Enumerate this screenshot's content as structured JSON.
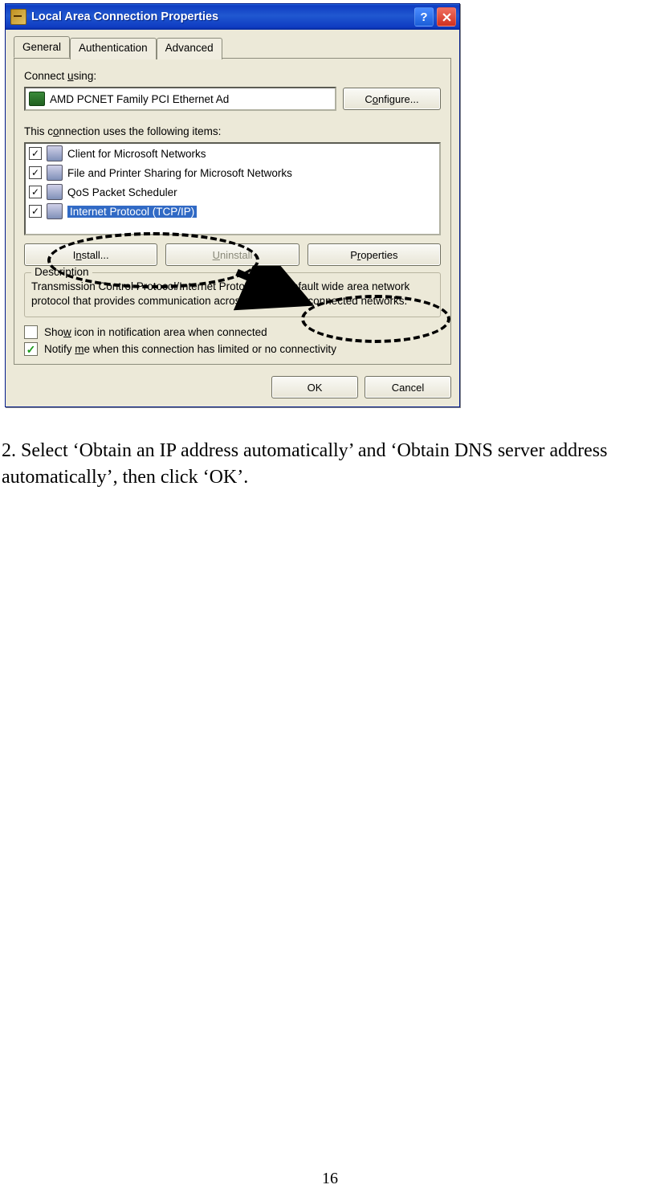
{
  "dialog": {
    "title": "Local Area Connection Properties",
    "tabs": [
      "General",
      "Authentication",
      "Advanced"
    ],
    "connect_label_pre": "Connect ",
    "connect_label_u": "u",
    "connect_label_post": "sing:",
    "adapter": "AMD PCNET Family PCI Ethernet Ad",
    "configure_pre": "C",
    "configure_u": "o",
    "configure_post": "nfigure...",
    "items_label_pre": "This c",
    "items_label_u": "o",
    "items_label_post": "nnection uses the following items:",
    "items": [
      {
        "name": "Client for Microsoft Networks",
        "checked": true
      },
      {
        "name": "File and Printer Sharing for Microsoft Networks",
        "checked": true
      },
      {
        "name": "QoS Packet Scheduler",
        "checked": true
      },
      {
        "name": "Internet Protocol (TCP/IP)",
        "checked": true,
        "selected": true
      }
    ],
    "install_u": "n",
    "install_pre": "I",
    "install_post": "stall...",
    "uninstall_u": "U",
    "uninstall_post": "ninstall",
    "properties_u": "r",
    "properties_pre": "P",
    "properties_post": "operties",
    "desc_legend": "Description",
    "desc_text": "Transmission Control Protocol/Internet Protocol. The default wide area network protocol that provides communication across diverse interconnected networks.",
    "show_icon_pre": "Sho",
    "show_icon_u": "w",
    "show_icon_post": " icon in notification area when connected",
    "notify_pre": "Notify ",
    "notify_u": "m",
    "notify_post": "e when this connection has limited or no connectivity",
    "ok": "OK",
    "cancel": "Cancel"
  },
  "instruction": "2. Select ‘Obtain an IP address automatically’ and ‘Obtain DNS server address automatically’, then click ‘OK’.",
  "page_number": "16"
}
